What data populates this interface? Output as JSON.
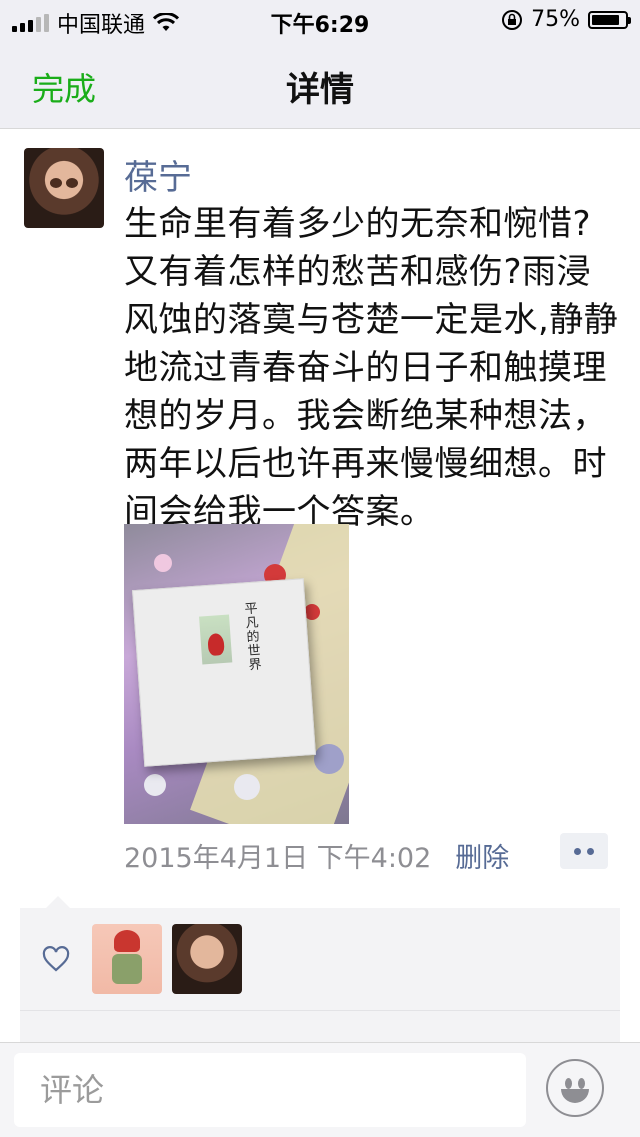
{
  "status_bar": {
    "carrier": "中国联通",
    "time": "下午6:29",
    "battery_percent": "75%",
    "battery_level": 0.75
  },
  "nav": {
    "done_label": "完成",
    "title": "详情"
  },
  "post": {
    "author": "葆宁",
    "text": "生命里有着多少的无奈和惋惜?又有着怎样的愁苦和感伤?雨浸风蚀的落寞与苍楚一定是水,静静地流过青春奋斗的日子和触摸理想的岁月。我会断绝某种想法，两年以后也许再来慢慢细想。时间会给我一个答案。",
    "photo_book_title": "平凡的世界",
    "timestamp": "2015年4月1日 下午4:02",
    "delete_label": "删除"
  },
  "likes": {
    "icon": "heart-outline-icon",
    "count": 2
  },
  "comment": {
    "placeholder": "评论",
    "emoji_icon": "emoji-icon"
  },
  "colors": {
    "accent_green": "#1aad19",
    "link_blue": "#576b95",
    "nav_bg": "#efeff4"
  }
}
